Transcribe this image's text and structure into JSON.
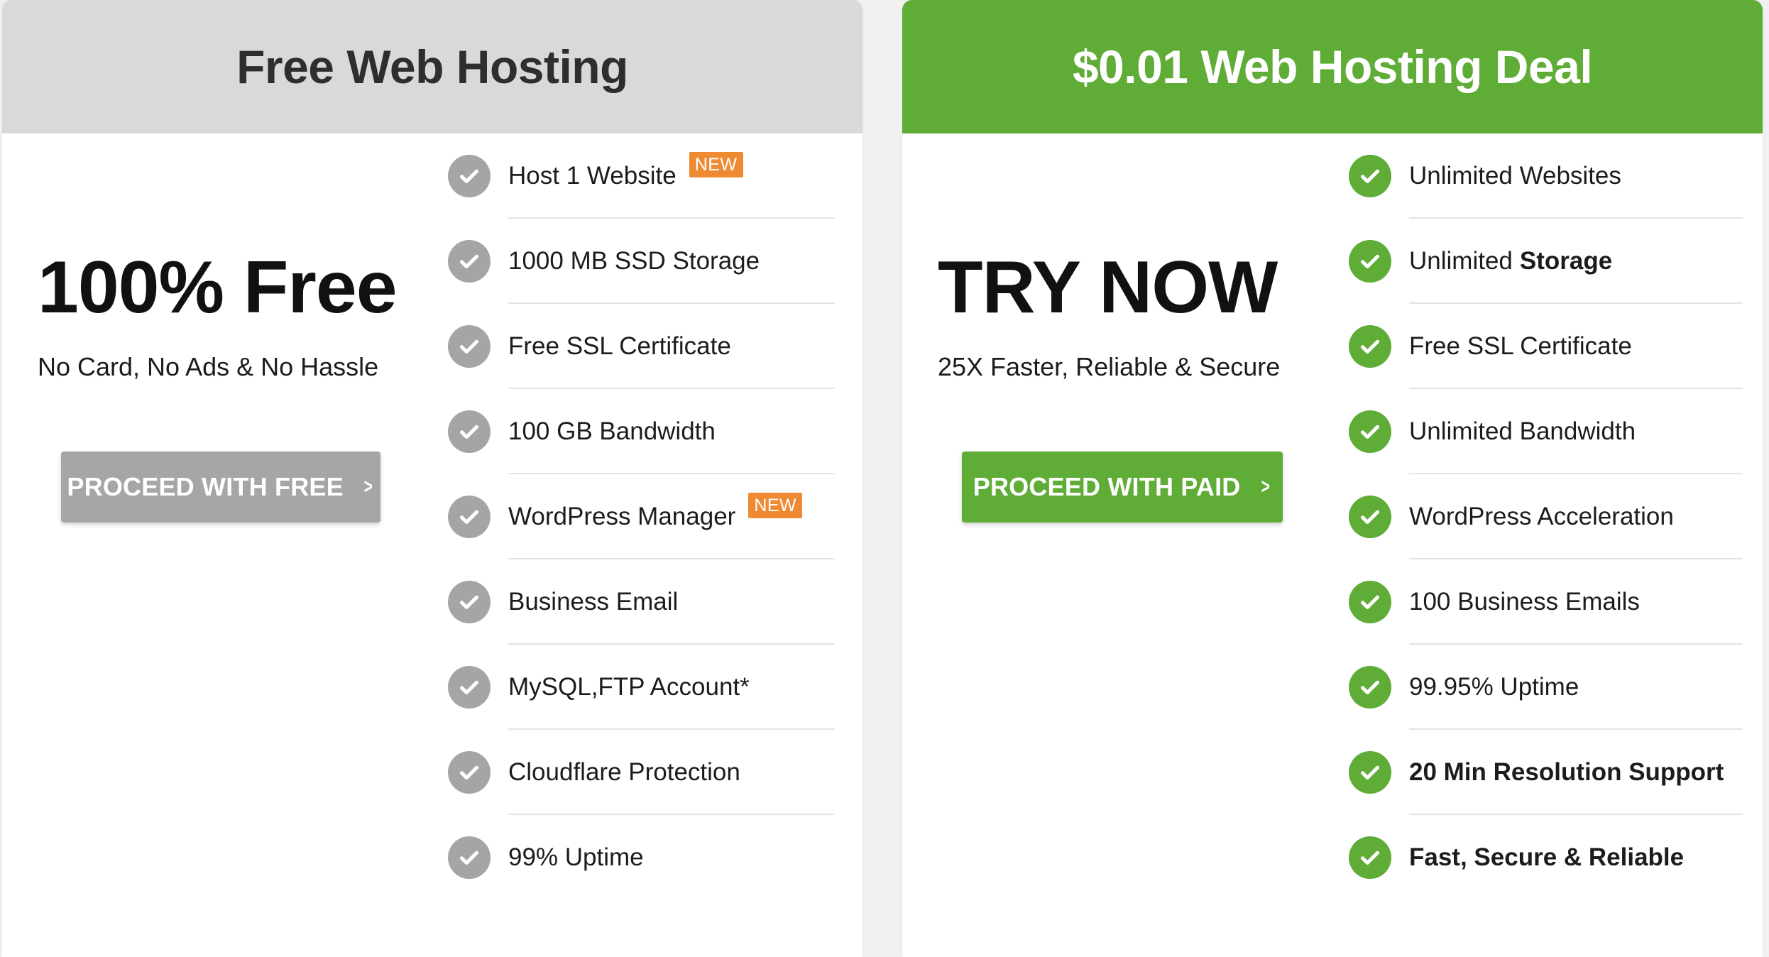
{
  "free_plan": {
    "header": "Free Web Hosting",
    "title": "100% Free",
    "subtitle": "No Card, No Ads & No Hassle",
    "button_label": "PROCEED WITH FREE",
    "features": [
      {
        "text": "Host 1 Website",
        "badge": "NEW"
      },
      {
        "text": "1000 MB SSD Storage"
      },
      {
        "text": "Free SSL Certificate"
      },
      {
        "text": "100 GB Bandwidth"
      },
      {
        "text": "WordPress Manager",
        "badge": "NEW"
      },
      {
        "text": "Business Email"
      },
      {
        "text": "MySQL,FTP Account*"
      },
      {
        "text": "Cloudflare Protection"
      },
      {
        "text": "99% Uptime"
      }
    ]
  },
  "paid_plan": {
    "header": "$0.01 Web Hosting Deal",
    "title": "TRY NOW",
    "subtitle": "25X Faster, Reliable & Secure",
    "button_label": "PROCEED WITH PAID",
    "features": [
      {
        "text": "Unlimited Websites"
      },
      {
        "text": "Unlimited",
        "strong": "Storage"
      },
      {
        "text": "Free SSL Certificate"
      },
      {
        "text": "Unlimited Bandwidth"
      },
      {
        "text": "WordPress Acceleration"
      },
      {
        "text": "100 Business Emails"
      },
      {
        "text": "99.95% Uptime"
      },
      {
        "text": "20 Min Resolution Support",
        "bold": true
      },
      {
        "text": "Fast, Secure & Reliable",
        "bold": true
      }
    ]
  },
  "icons": {
    "feature_check": "check-circle-icon",
    "button_arrow": "chevron-right-icon"
  },
  "colors": {
    "paid_accent": "#5fac37",
    "free_accent": "#a6a6a6",
    "free_header_bg": "#d9d9d9",
    "badge": "#ee8a32"
  }
}
